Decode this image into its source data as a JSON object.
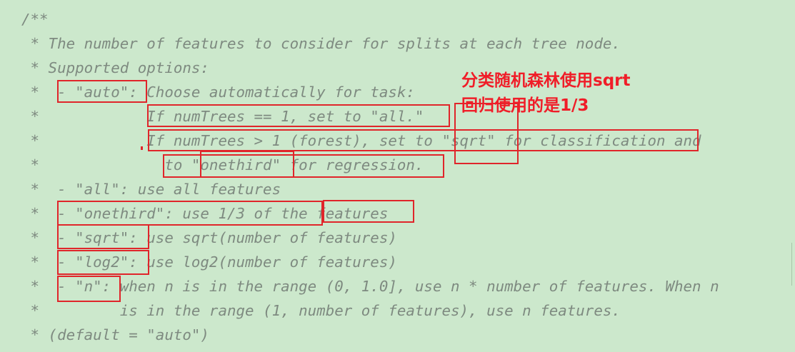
{
  "code": {
    "lines": [
      "/**",
      " * The number of features to consider for splits at each tree node.",
      " * Supported options:",
      " *  - \"auto\": Choose automatically for task:",
      " *            If numTrees == 1, set to \"all.\"",
      " *            If numTrees > 1 (forest), set to \"sqrt\" for classification and",
      " *              to \"onethird\" for regression.",
      " *  - \"all\": use all features",
      " *  - \"onethird\": use 1/3 of the features",
      " *  - \"sqrt\": use sqrt(number of features)",
      " *  - \"log2\": use log2(number of features)",
      " *  - \"n\": when n is in the range (0, 1.0], use n * number of features. When n",
      " *         is in the range (1, number of features), use n features.",
      " * (default = \"auto\")"
    ]
  },
  "annotations": {
    "line1": "分类随机森林使用sqrt",
    "line2": "回归使用的是1/3"
  },
  "colors": {
    "background": "#cce8cc",
    "comment_text": "#7e8a80",
    "highlight_box": "#e0252a",
    "annotation_text": "#f01d28"
  }
}
